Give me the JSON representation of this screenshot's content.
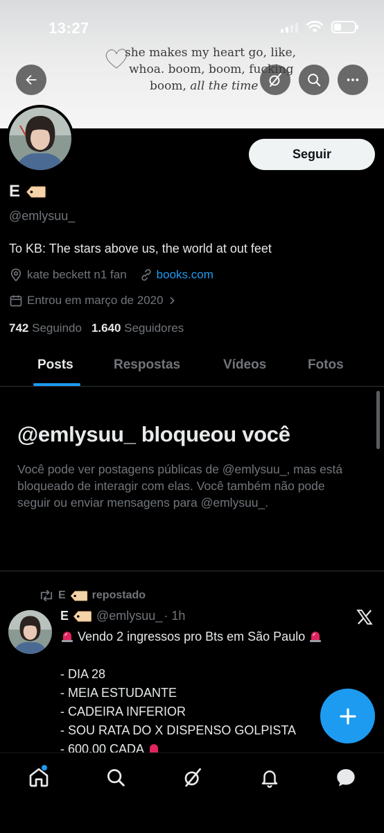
{
  "status_bar": {
    "time": "13:27"
  },
  "banner": {
    "quote_lines": [
      "she makes my heart go, like,",
      "whoa. boom, boom, fucking",
      "boom,"
    ],
    "quote_tail": "all the time"
  },
  "profile": {
    "display_name": "E",
    "handle": "@emlysuu_",
    "bio": "To KB: The stars above us, the world at out feet",
    "location": "kate beckett n1 fan",
    "website": "books.com",
    "joined": "Entrou em março de 2020",
    "following_count": "742",
    "following_label": "Seguindo",
    "followers_count": "1.640",
    "followers_label": "Seguidores",
    "follow_label": "Seguir"
  },
  "tabs": [
    {
      "label": "Posts",
      "active": true
    },
    {
      "label": "Respostas",
      "active": false
    },
    {
      "label": "Vídeos",
      "active": false
    },
    {
      "label": "Fotos",
      "active": false
    }
  ],
  "blocked": {
    "title": "@emlysuu_ bloqueou você",
    "description": "Você pode ver postagens públicas de @emlysuu_, mas está bloqueado de interagir com elas. Você também não pode seguir ou enviar mensagens para @emlysuu_."
  },
  "tweet": {
    "repost_name": "E",
    "repost_label": "repostado",
    "author_name": "E",
    "author_handle": "@emlysuu_",
    "time": "· 1h",
    "lines": [
      "Vendo 2 ingressos pro Bts em São Paulo",
      "",
      "- DIA 28",
      "- MEIA ESTUDANTE",
      "- CADEIRA INFERIOR",
      "- SOU RATA DO X DISPENSO GOLPISTA",
      "- 600,00 CADA"
    ]
  },
  "colors": {
    "accent": "#1d9bf0",
    "background": "#000000",
    "text_primary": "#e7e9ea",
    "text_secondary": "#71767b"
  },
  "icons": [
    "back-arrow-icon",
    "grok-icon",
    "search-icon",
    "more-icon",
    "location-icon",
    "link-icon",
    "calendar-icon",
    "chevron-right-icon",
    "repost-icon",
    "x-logo-icon",
    "siren-icon",
    "plus-icon",
    "home-icon",
    "explore-icon",
    "notifications-icon",
    "messages-icon"
  ]
}
